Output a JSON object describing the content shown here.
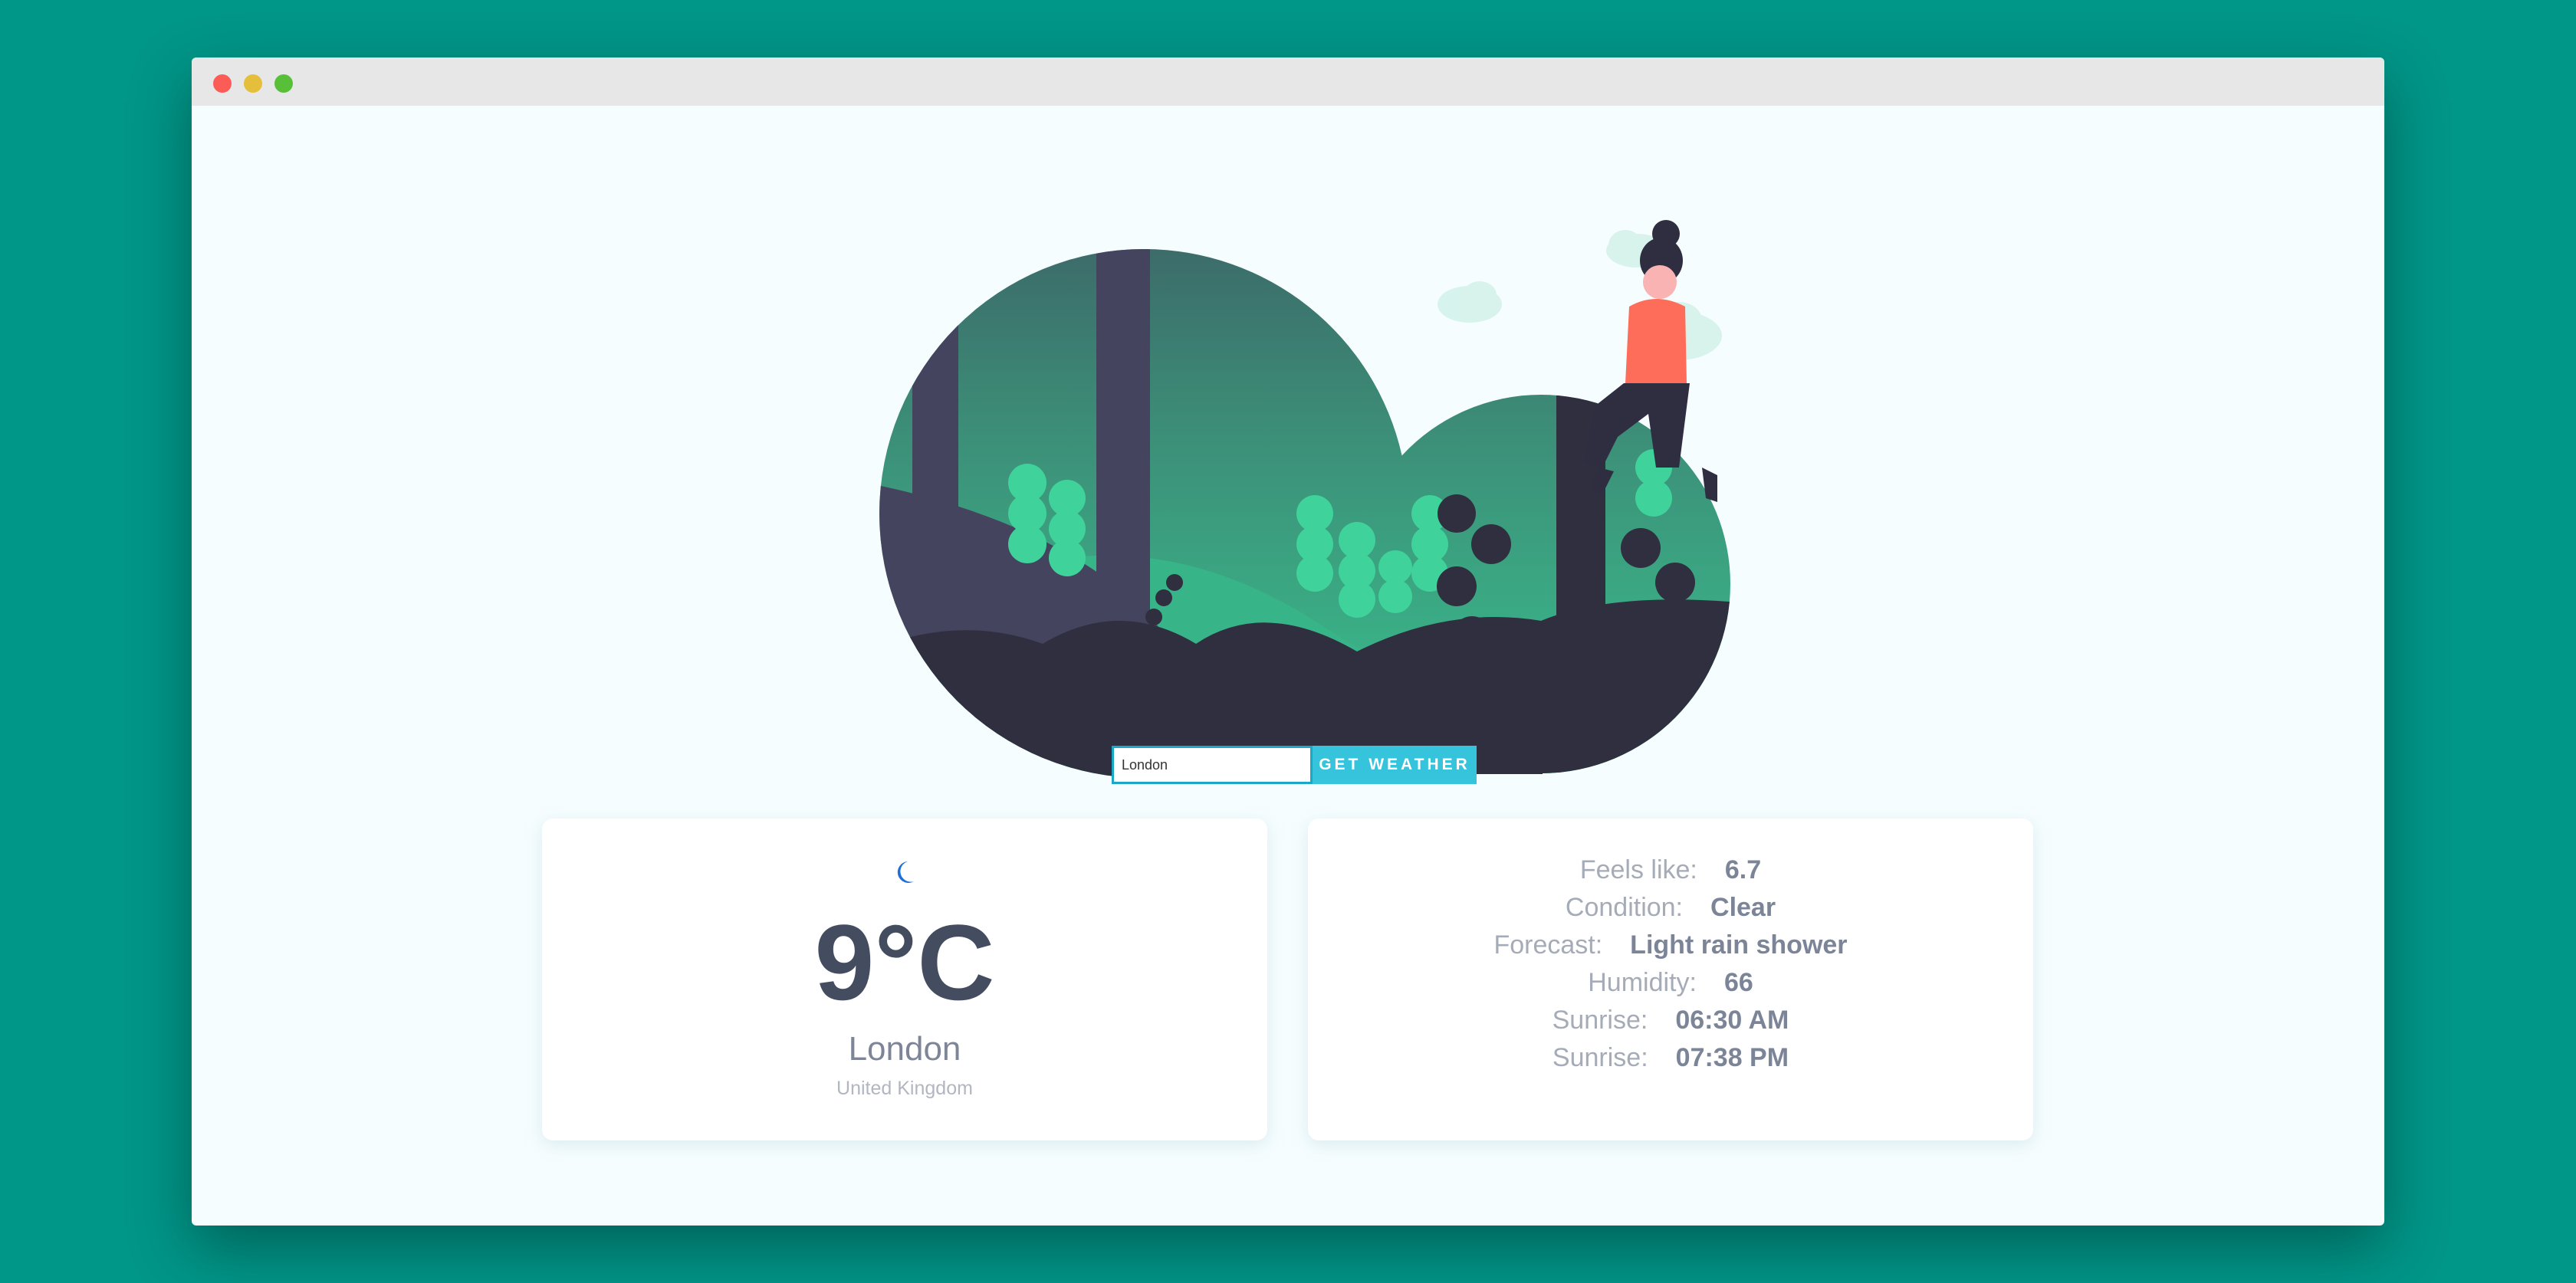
{
  "search": {
    "value": "London",
    "button_label": "GET WEATHER"
  },
  "weather": {
    "icon": "moon-icon",
    "temperature": "9°C",
    "city": "London",
    "country": "United Kingdom"
  },
  "details": [
    {
      "label": "Feels like:",
      "value": "6.7"
    },
    {
      "label": "Condition:",
      "value": "Clear"
    },
    {
      "label": "Forecast:",
      "value": "Light rain shower"
    },
    {
      "label": "Humidity:",
      "value": "66"
    },
    {
      "label": "Sunrise:",
      "value": "06:30 AM"
    },
    {
      "label": "Sunrise:",
      "value": "07:38 PM"
    }
  ],
  "colors": {
    "background": "#009688",
    "accent": "#36c3dc",
    "text_dark": "#434d5f"
  }
}
